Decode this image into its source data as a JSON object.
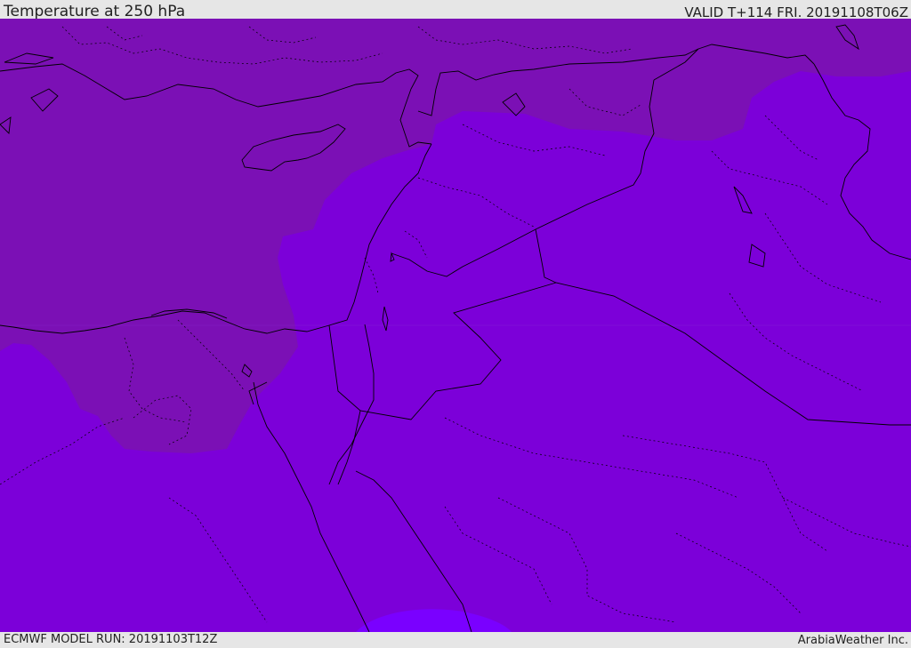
{
  "header": {
    "title": "Temperature at 250 hPa",
    "valid": "VALID T+114 FRI. 20191108T06Z"
  },
  "footer": {
    "model_run": "ECMWF MODEL RUN: 20191103T12Z",
    "credit": "ArabiaWeather Inc."
  },
  "map": {
    "field": "Temperature at 250 hPa",
    "colors": {
      "cold_band": "#7b10b5",
      "mid_band": "#7c00d9",
      "warm_patch": "#7a00ff",
      "border_line": "#000000"
    }
  }
}
